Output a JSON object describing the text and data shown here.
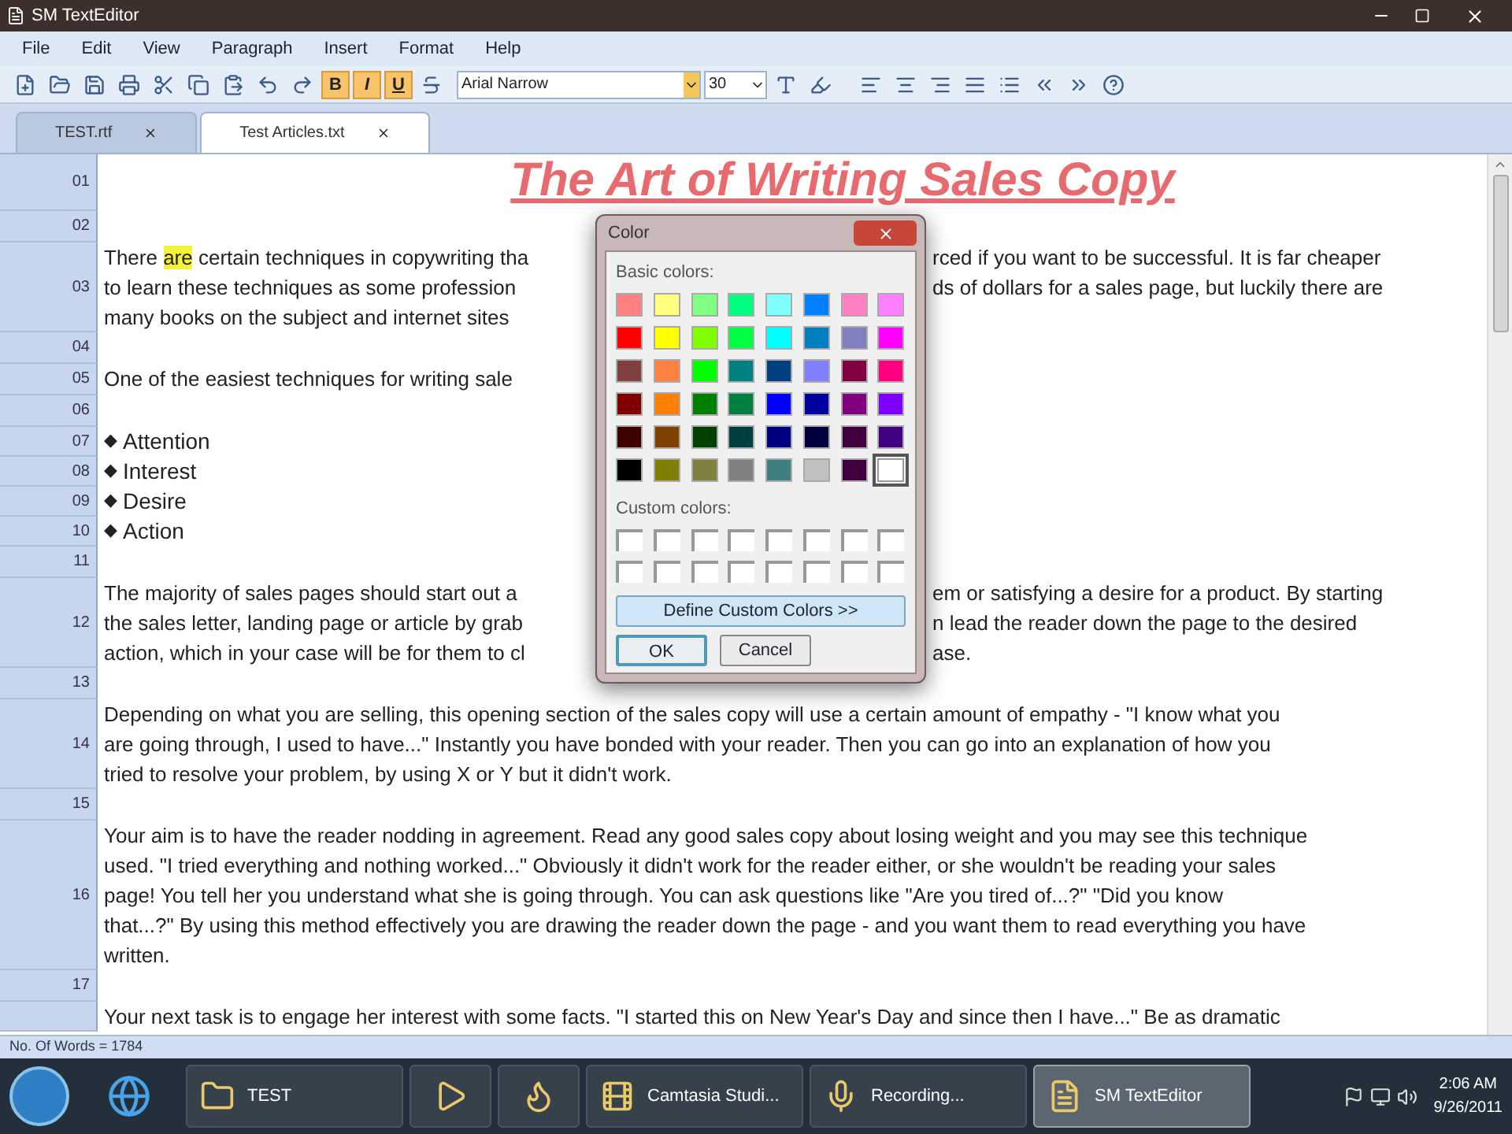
{
  "window": {
    "title": "SM TextEditor"
  },
  "menu": [
    "File",
    "Edit",
    "View",
    "Paragraph",
    "Insert",
    "Format",
    "Help"
  ],
  "toolbar": {
    "format_buttons": [
      {
        "label": "B",
        "kind": "bold",
        "active": true
      },
      {
        "label": "I",
        "kind": "italic",
        "active": true
      },
      {
        "label": "U",
        "kind": "underline",
        "active": true
      }
    ],
    "font": "Arial Narrow",
    "size": "30"
  },
  "tabs": [
    {
      "label": "TEST.rtf",
      "selected": false
    },
    {
      "label": "Test Articles.txt",
      "selected": true
    }
  ],
  "document": {
    "rows": [
      {
        "number": "01",
        "kind": "title",
        "text": "The Art of Writing Sales Copy"
      },
      {
        "number": "02",
        "kind": "blank"
      },
      {
        "number": "03",
        "kind": "para",
        "lines": [
          {
            "kind": "split",
            "left": [
              {
                "text": "There ",
                "highlighted": false
              },
              {
                "text": "are",
                "highlighted": true
              },
              {
                "text": " certain techniques in copywriting tha",
                "highlighted": false
              }
            ],
            "right": "rced if you want to be successful. It is far cheaper"
          },
          {
            "kind": "split",
            "left": [
              {
                "text": "to learn these techniques as some profession",
                "highlighted": false
              }
            ],
            "right": "ds of dollars for a sales page, but luckily there are"
          },
          {
            "kind": "split",
            "left": [
              {
                "text": "many books on the subject and internet sites",
                "highlighted": false
              }
            ]
          }
        ]
      },
      {
        "number": "04",
        "kind": "blank"
      },
      {
        "number": "05",
        "kind": "para",
        "lines": [
          {
            "kind": "split",
            "left": [
              {
                "text": "One of the easiest techniques for writing sale",
                "highlighted": false
              }
            ]
          }
        ]
      },
      {
        "number": "06",
        "kind": "blank"
      },
      {
        "number": "07",
        "kind": "bullet",
        "marker": "◆",
        "text": "Attention"
      },
      {
        "number": "08",
        "kind": "bullet",
        "marker": "◆",
        "text": "Interest"
      },
      {
        "number": "09",
        "kind": "bullet",
        "marker": "◆",
        "text": "Desire"
      },
      {
        "number": "10",
        "kind": "bullet",
        "marker": "◆",
        "text": "Action"
      },
      {
        "number": "11",
        "kind": "blank"
      },
      {
        "number": "12",
        "kind": "para",
        "lines": [
          {
            "kind": "split",
            "left": [
              {
                "text": "The majority of sales pages should start out a",
                "highlighted": false
              }
            ],
            "right": "em or satisfying a desire for a product. By starting"
          },
          {
            "kind": "split",
            "left": [
              {
                "text": "the sales letter, landing page or article by grab",
                "highlighted": false
              }
            ],
            "right": "n lead the reader down the page to the desired"
          },
          {
            "kind": "split",
            "left": [
              {
                "text": "action, which in your case will be for them to cl",
                "highlighted": false
              }
            ],
            "right": "ase."
          }
        ]
      },
      {
        "number": "13",
        "kind": "blank"
      },
      {
        "number": "14",
        "kind": "para",
        "lines": [
          {
            "kind": "full",
            "text": "Depending on what you are selling, this opening section of the sales copy will use a certain amount of empathy - \"I know what you"
          },
          {
            "kind": "full",
            "text": "are going through, I used to have...\" Instantly you have bonded with your reader. Then you can go into an explanation of how you"
          },
          {
            "kind": "full",
            "text": "tried to resolve your problem, by using X or Y but it didn't work."
          }
        ]
      },
      {
        "number": "15",
        "kind": "blank"
      },
      {
        "number": "16",
        "kind": "para",
        "lines": [
          {
            "kind": "full",
            "text": "Your aim is to have the reader nodding in agreement. Read any good sales copy about losing weight and you may see this technique"
          },
          {
            "kind": "full",
            "text": "used. \"I tried everything and nothing worked...\" Obviously it didn't work for the reader either, or she wouldn't be reading your sales"
          },
          {
            "kind": "full",
            "text": "page! You tell her you understand what she is going through. You can ask questions like \"Are you tired of...?\" \"Did you know"
          },
          {
            "kind": "full",
            "text": "that...?\" By using this method effectively you are drawing the reader down the page - and you want them to read everything you have"
          },
          {
            "kind": "full",
            "text": "written."
          }
        ]
      },
      {
        "number": "17",
        "kind": "blank"
      },
      {
        "kind": "para",
        "lines": [
          {
            "kind": "full",
            "text": "Your next task is to engage her interest with some facts. \"I started this on New Year's Day and since then I have...\" Be as dramatic"
          }
        ]
      }
    ]
  },
  "color_dialog": {
    "title": "Color",
    "basic_label": "Basic colors:",
    "basic_colors": [
      {
        "color": "#ff8080",
        "selected": false
      },
      {
        "color": "#ffff80",
        "selected": false
      },
      {
        "color": "#80ff80",
        "selected": false
      },
      {
        "color": "#00ff80",
        "selected": false
      },
      {
        "color": "#80ffff",
        "selected": false
      },
      {
        "color": "#0080ff",
        "selected": false
      },
      {
        "color": "#ff80c0",
        "selected": false
      },
      {
        "color": "#ff80ff",
        "selected": false
      },
      {
        "color": "#ff0000",
        "selected": false
      },
      {
        "color": "#ffff00",
        "selected": false
      },
      {
        "color": "#80ff00",
        "selected": false
      },
      {
        "color": "#00ff40",
        "selected": false
      },
      {
        "color": "#00ffff",
        "selected": false
      },
      {
        "color": "#0080c0",
        "selected": false
      },
      {
        "color": "#8080c0",
        "selected": false
      },
      {
        "color": "#ff00ff",
        "selected": false
      },
      {
        "color": "#804040",
        "selected": false
      },
      {
        "color": "#ff8040",
        "selected": false
      },
      {
        "color": "#00ff00",
        "selected": false
      },
      {
        "color": "#008080",
        "selected": false
      },
      {
        "color": "#004080",
        "selected": false
      },
      {
        "color": "#8080ff",
        "selected": false
      },
      {
        "color": "#800040",
        "selected": false
      },
      {
        "color": "#ff0080",
        "selected": false
      },
      {
        "color": "#800000",
        "selected": false
      },
      {
        "color": "#ff8000",
        "selected": false
      },
      {
        "color": "#008000",
        "selected": false
      },
      {
        "color": "#008040",
        "selected": false
      },
      {
        "color": "#0000ff",
        "selected": false
      },
      {
        "color": "#0000a0",
        "selected": false
      },
      {
        "color": "#800080",
        "selected": false
      },
      {
        "color": "#8000ff",
        "selected": false
      },
      {
        "color": "#400000",
        "selected": false
      },
      {
        "color": "#804000",
        "selected": false
      },
      {
        "color": "#004000",
        "selected": false
      },
      {
        "color": "#004040",
        "selected": false
      },
      {
        "color": "#000080",
        "selected": false
      },
      {
        "color": "#000040",
        "selected": false
      },
      {
        "color": "#400040",
        "selected": false
      },
      {
        "color": "#400080",
        "selected": false
      },
      {
        "color": "#000000",
        "selected": false
      },
      {
        "color": "#808000",
        "selected": false
      },
      {
        "color": "#808040",
        "selected": false
      },
      {
        "color": "#808080",
        "selected": false
      },
      {
        "color": "#408080",
        "selected": false
      },
      {
        "color": "#c0c0c0",
        "selected": false
      },
      {
        "color": "#400040",
        "selected": false
      },
      {
        "color": "#ffffff",
        "selected": true
      }
    ],
    "custom_label": "Custom colors:",
    "define_button": "Define Custom Colors >>",
    "ok_button": "OK",
    "cancel_button": "Cancel"
  },
  "status_bar": "No. Of Words = 1784",
  "taskbar": {
    "items": [
      {
        "kind": "folder",
        "label": "TEST",
        "selected": false
      },
      {
        "kind": "player",
        "selected": false
      },
      {
        "kind": "browser",
        "selected": false
      },
      {
        "kind": "camtasia",
        "label": "Camtasia Studi...",
        "selected": false
      },
      {
        "kind": "recording",
        "label": "Recording...",
        "selected": false
      },
      {
        "kind": "editor",
        "label": "SM TextEditor",
        "selected": true
      }
    ],
    "time": "2:06 AM",
    "date": "9/26/2011"
  }
}
